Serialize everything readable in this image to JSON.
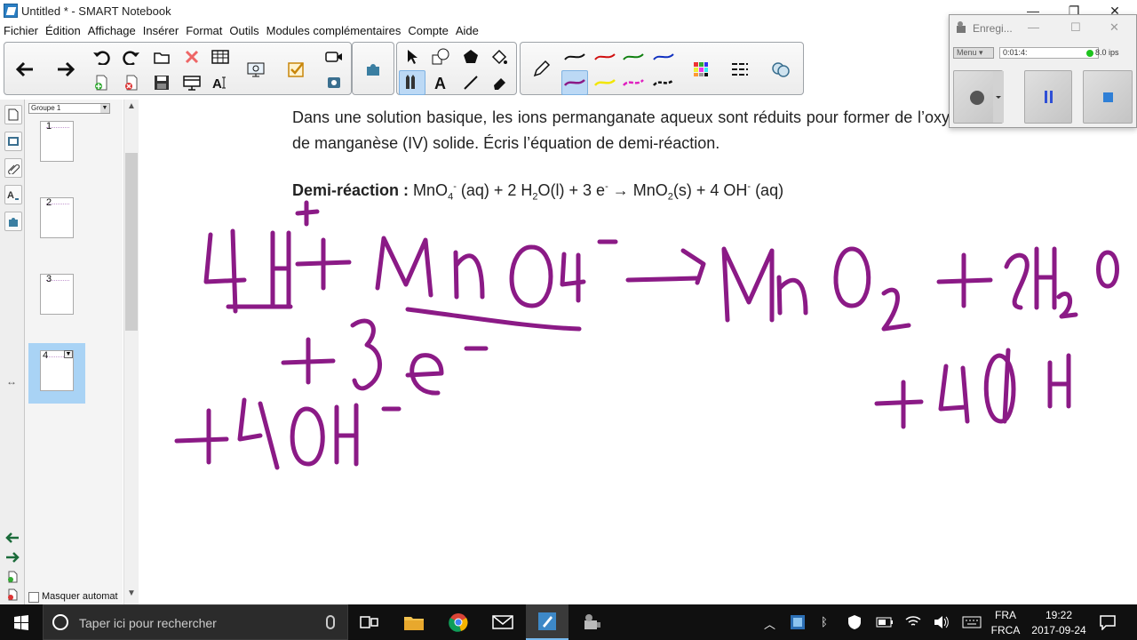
{
  "window": {
    "title": "Untitled * - SMART Notebook",
    "minimize": "—",
    "restore": "❐",
    "close": "✕"
  },
  "menu": [
    "Fichier",
    "Édition",
    "Affichage",
    "Insérer",
    "Format",
    "Outils",
    "Modules complémentaires",
    "Compte",
    "Aide"
  ],
  "sorter": {
    "group_label": "Groupe 1",
    "pages": [
      "1",
      "2",
      "3",
      "4"
    ],
    "selected_page": "4",
    "hide_label": "Masquer automat"
  },
  "canvas": {
    "prompt": "Dans une solution basique, les ions permanganate aqueux sont réduits pour former de l’oxyde de manganèse (IV) solide. Écris l’équation de demi-réaction.",
    "equation_label": "Demi-réaction :",
    "eq": {
      "p1": "MnO",
      "sub4": "4",
      "supminus": "-",
      "p2": " (aq) + 2 H",
      "sub2": "2",
      "p3": "O(l) + 3 e",
      "supminus2": "-",
      "p4": " → MnO",
      "sub2b": "2",
      "p5": "(s) + 4 OH",
      "supminus3": "-",
      "p6": " (aq)"
    },
    "ink_color": "#8b1a86"
  },
  "recorder": {
    "title": "Enregi...",
    "menu_label": "Menu",
    "time": "0:01:4:",
    "fps": "8.0 ips"
  },
  "taskbar": {
    "search_placeholder": "Taper ici pour rechercher",
    "lang_top": "FRA",
    "lang_bottom": "FRCA",
    "time": "19:22",
    "date": "2017-09-24"
  }
}
